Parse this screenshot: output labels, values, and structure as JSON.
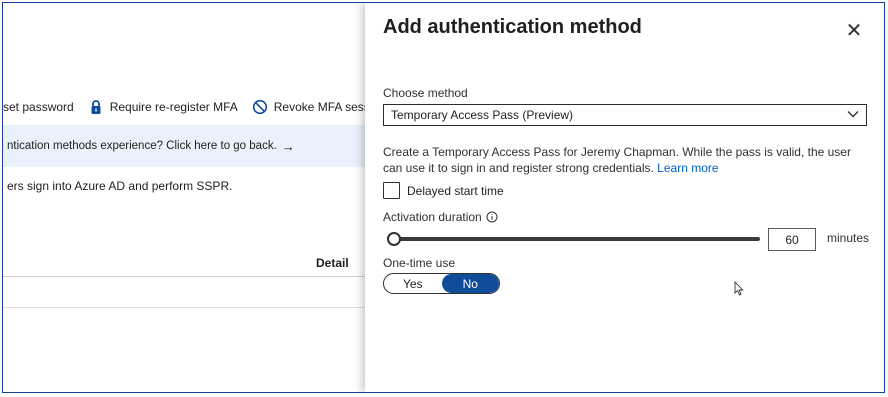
{
  "background": {
    "toolbar": {
      "reset_password": "set password",
      "require_mfa": "Require re-register MFA",
      "revoke_mfa": "Revoke MFA session"
    },
    "banner": {
      "text": "ntication methods experience? Click here to go back.",
      "arrow": "→"
    },
    "description": "ers sign into Azure AD and perform SSPR.",
    "table": {
      "column_detail": "Detail"
    }
  },
  "panel": {
    "title": "Add authentication method",
    "close_glyph": "✕",
    "choose_method": {
      "label": "Choose method",
      "selected": "Temporary Access Pass (Preview)"
    },
    "description": "Create a Temporary Access Pass for Jeremy Chapman. While the pass is valid, the user can use it to sign in and register strong credentials.",
    "learn_more": "Learn more",
    "delayed_start": {
      "label": "Delayed start time",
      "checked": false
    },
    "activation": {
      "label": "Activation duration",
      "value": "60",
      "unit": "minutes",
      "slider_fraction": 0.0
    },
    "one_time_use": {
      "label": "One-time use",
      "options": [
        "Yes",
        "No"
      ],
      "selected": "No"
    }
  },
  "colors": {
    "accent": "#0f4c9a",
    "link": "#0060c8",
    "banner_bg": "#e9f1fc",
    "frame_border": "#1a3f9a"
  }
}
